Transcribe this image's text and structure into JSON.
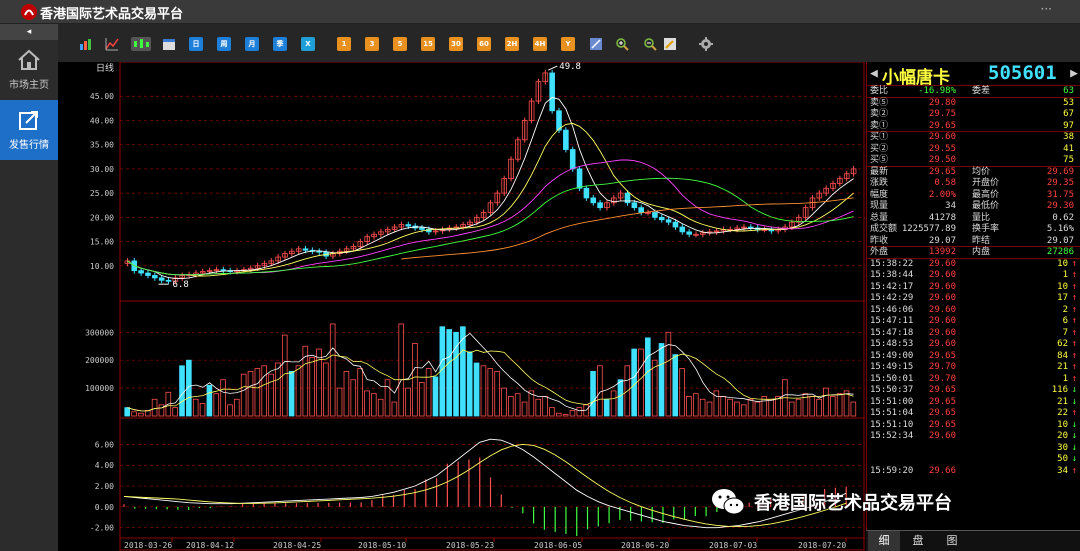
{
  "app": {
    "title": "香港国际艺术品交易平台"
  },
  "sidebar": {
    "collapse_label": "◂",
    "items": [
      {
        "label": "市场主页",
        "icon": "home-icon",
        "active": false
      },
      {
        "label": "发售行情",
        "icon": "share-icon",
        "active": true
      }
    ]
  },
  "toolbar": {
    "chart_type_buttons": [
      "bar-chart-icon",
      "line-chart-icon",
      "candlestick-icon",
      "calendar-icon"
    ],
    "period_buttons": [
      "日",
      "周",
      "月",
      "季",
      "X",
      "1",
      "3",
      "5",
      "15",
      "30",
      "60",
      "2H",
      "4H",
      "Y"
    ],
    "tool_buttons": [
      "draw-icon",
      "zoom-in-icon",
      "zoom-out-icon",
      "pencil-icon",
      "gear-icon"
    ]
  },
  "chart": {
    "period_label": "日线",
    "price_axis_labels": [
      "45.00",
      "40.00",
      "35.00",
      "30.00",
      "25.00",
      "20.00",
      "15.00",
      "10.00"
    ],
    "volume_axis_labels": [
      "300000",
      "200000",
      "100000"
    ],
    "macd_axis_labels": [
      "6.00",
      "4.00",
      "2.00",
      "0.00",
      "-2.00"
    ],
    "date_labels": [
      "2018-03-26",
      "2018-04-12",
      "2018-04-25",
      "2018-05-10",
      "2018-05-23",
      "2018-06-05",
      "2018-06-20",
      "2018-07-03",
      "2018-07-20"
    ],
    "high_marker": "49.8",
    "low_marker": "6.8",
    "colors": {
      "up": "#ff5050",
      "down": "#40e0ff",
      "grid": "#8b0000",
      "ma5": "#ffffff",
      "ma10": "#ffff60",
      "ma20": "#ff40ff",
      "ma30": "#40ff40",
      "ma60": "#ff9030"
    },
    "chart_data": {
      "type": "candlestick",
      "closes": [
        11,
        9,
        8.5,
        8,
        7.5,
        7,
        6.8,
        7.5,
        8,
        8.2,
        8.5,
        8.8,
        9,
        9.2,
        9,
        8.8,
        9,
        9.2,
        9.5,
        10,
        10.5,
        11,
        11.8,
        12.5,
        13,
        13.5,
        13.2,
        13,
        12.8,
        12,
        12.5,
        13,
        13.5,
        14,
        15,
        16,
        16.5,
        17,
        17.5,
        18,
        18.5,
        18.2,
        17.8,
        17.5,
        17,
        17.2,
        17.5,
        17.8,
        18,
        18.5,
        19,
        20,
        21,
        23,
        25,
        28,
        32,
        36,
        40,
        44,
        48,
        49.8,
        42,
        38,
        34,
        30,
        26,
        24,
        23,
        22,
        23,
        24,
        25,
        23,
        22,
        21,
        21,
        20,
        19.5,
        19,
        18,
        17,
        16.5,
        16.5,
        16.8,
        17,
        17.2,
        17.5,
        17.5,
        17.8,
        18,
        17.8,
        17.5,
        17.5,
        17.2,
        17.5,
        18,
        19,
        20,
        22,
        24,
        25,
        26,
        27,
        28,
        29,
        30
      ],
      "volumes": [
        30000,
        15000,
        10000,
        20000,
        60000,
        40000,
        85000,
        30000,
        180000,
        200000,
        60000,
        45000,
        110000,
        80000,
        130000,
        40000,
        60000,
        150000,
        160000,
        170000,
        180000,
        150000,
        190000,
        290000,
        160000,
        180000,
        250000,
        210000,
        240000,
        190000,
        330000,
        100000,
        160000,
        130000,
        170000,
        90000,
        80000,
        60000,
        130000,
        50000,
        330000,
        100000,
        260000,
        120000,
        170000,
        140000,
        320000,
        310000,
        300000,
        320000,
        230000,
        190000,
        180000,
        170000,
        160000,
        100000,
        70000,
        80000,
        50000,
        90000,
        60000,
        70000,
        30000,
        10000,
        5000,
        20000,
        30000,
        40000,
        160000,
        180000,
        60000,
        90000,
        130000,
        180000,
        240000,
        240000,
        280000,
        200000,
        260000,
        300000,
        220000,
        170000,
        70000,
        80000,
        60000,
        50000,
        90000,
        70000,
        60000,
        50000,
        40000,
        60000,
        50000,
        70000,
        60000,
        70000,
        130000,
        50000,
        60000,
        80000,
        70000,
        60000,
        100000,
        70000,
        80000,
        90000,
        50000
      ],
      "macd": [
        1,
        0.9,
        0.8,
        0.7,
        0.6,
        0.5,
        0.4,
        0.35,
        0.3,
        0.3,
        0.3,
        0.35,
        0.4,
        0.45,
        0.5,
        0.55,
        0.6,
        0.65,
        0.7,
        0.75,
        0.8,
        0.85,
        0.9,
        1,
        1.2,
        1.4,
        1.7,
        2,
        2.5,
        3,
        3.8,
        4.6,
        5.4,
        6.2,
        6.5,
        6.4,
        6,
        5.5,
        4.8,
        4,
        3.2,
        2.4,
        1.6,
        1,
        0.5,
        0.1,
        -0.2,
        -0.5,
        -0.8,
        -1.1,
        -1.4,
        -1.6,
        -1.8,
        -1.9,
        -2,
        -2,
        -1.9,
        -1.8,
        -1.6,
        -1.4,
        -1.1,
        -0.8,
        -0.5,
        -0.2,
        0.1,
        0.5,
        0.9,
        1.3
      ]
    }
  },
  "quote": {
    "name": "小幅唐卡",
    "code": "505601",
    "summary": [
      {
        "l1": "委比",
        "v1": "-16.98%",
        "c1": "green",
        "l2": "委差",
        "v2": "63",
        "c2": "green"
      }
    ],
    "sell": [
      {
        "label": "卖⑤",
        "price": "29.80",
        "vol": "53"
      },
      {
        "label": "卖②",
        "price": "29.75",
        "vol": "67"
      },
      {
        "label": "卖①",
        "price": "29.65",
        "vol": "97"
      }
    ],
    "buy": [
      {
        "label": "买①",
        "price": "29.60",
        "vol": "38"
      },
      {
        "label": "买②",
        "price": "29.55",
        "vol": "41"
      },
      {
        "label": "买⑤",
        "price": "29.50",
        "vol": "75"
      }
    ],
    "stats": [
      {
        "l1": "最新",
        "v1": "29.65",
        "c1": "red",
        "l2": "均价",
        "v2": "29.69",
        "c2": "red"
      },
      {
        "l1": "涨跌",
        "v1": "0.58",
        "c1": "red",
        "l2": "开盘价",
        "v2": "29.35",
        "c2": "red"
      },
      {
        "l1": "幅度",
        "v1": "2.00%",
        "c1": "red",
        "l2": "最高价",
        "v2": "31.75",
        "c2": "red"
      },
      {
        "l1": "现量",
        "v1": "34",
        "c1": "white",
        "l2": "最低价",
        "v2": "29.30",
        "c2": "red"
      },
      {
        "l1": "总量",
        "v1": "41278",
        "c1": "white",
        "l2": "量比",
        "v2": "0.62",
        "c2": "white"
      },
      {
        "l1": "成交额",
        "v1": "1225577.89",
        "c1": "white",
        "l2": "换手率",
        "v2": "5.16%",
        "c2": "white"
      },
      {
        "l1": "昨收",
        "v1": "29.07",
        "c1": "white",
        "l2": "昨结",
        "v2": "29.07",
        "c2": "white"
      }
    ],
    "outer_inner": {
      "l1": "外盘",
      "v1": "13992",
      "l2": "内盘",
      "v2": "27286"
    },
    "ticks": [
      {
        "time": "15:38:22",
        "price": "29.60",
        "vol": "10",
        "dir": "up"
      },
      {
        "time": "15:38:44",
        "price": "29.60",
        "vol": "1",
        "dir": "up"
      },
      {
        "time": "15:42:17",
        "price": "29.60",
        "vol": "10",
        "dir": "up"
      },
      {
        "time": "15:42:29",
        "price": "29.60",
        "vol": "17",
        "dir": "up"
      },
      {
        "time": "15:46:06",
        "price": "29.60",
        "vol": "2",
        "dir": "up"
      },
      {
        "time": "15:47:11",
        "price": "29.60",
        "vol": "6",
        "dir": "up"
      },
      {
        "time": "15:47:18",
        "price": "29.60",
        "vol": "7",
        "dir": "up"
      },
      {
        "time": "15:48:53",
        "price": "29.60",
        "vol": "62",
        "dir": "up"
      },
      {
        "time": "15:49:00",
        "price": "29.65",
        "vol": "84",
        "dir": "up"
      },
      {
        "time": "15:49:15",
        "price": "29.70",
        "vol": "21",
        "dir": "up"
      },
      {
        "time": "15:50:01",
        "price": "29.70",
        "vol": "1",
        "dir": "up"
      },
      {
        "time": "15:50:37",
        "price": "29.65",
        "vol": "116",
        "dir": "down"
      },
      {
        "time": "15:51:00",
        "price": "29.65",
        "vol": "21",
        "dir": "down"
      },
      {
        "time": "15:51:04",
        "price": "29.65",
        "vol": "22",
        "dir": "up"
      },
      {
        "time": "15:51:10",
        "price": "29.65",
        "vol": "10",
        "dir": "down"
      },
      {
        "time": "15:52:34",
        "price": "29.60",
        "vol": "20",
        "dir": "down"
      },
      {
        "time": "",
        "price": "",
        "vol": "30",
        "dir": "down"
      },
      {
        "time": "",
        "price": "",
        "vol": "50",
        "dir": "down"
      },
      {
        "time": "15:59:20",
        "price": "29.66",
        "vol": "34",
        "dir": "up"
      }
    ]
  },
  "tabs": [
    "细",
    "盘",
    "图"
  ],
  "watermark": {
    "text": "香港国际艺术品交易平台",
    "icon": "wechat-icon"
  }
}
